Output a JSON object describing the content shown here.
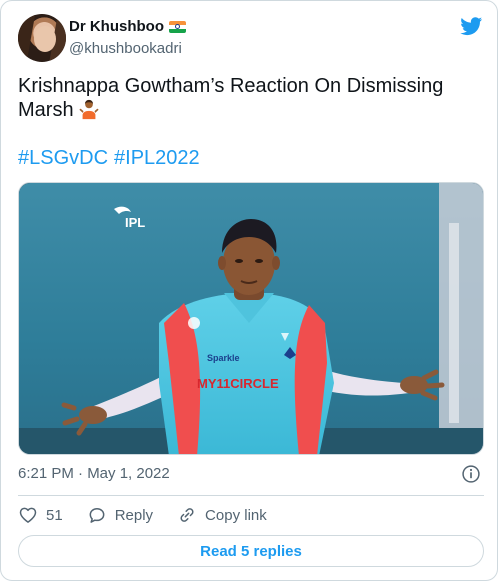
{
  "author": {
    "display_name": "Dr Khushboo",
    "handle": "@khushbookadri"
  },
  "tweet": {
    "text": "Krishnappa Gowtham’s Reaction On Dismissing Marsh",
    "hashtags": [
      "#LSGvDC",
      "#IPL2022"
    ],
    "timestamp": "6:21 PM · May 1, 2022"
  },
  "media": {
    "overlay_logo_text": "IPL",
    "jersey_sponsor_1": "Sparkle",
    "jersey_sponsor_2": "MY11CIRCLE"
  },
  "actions": {
    "like_count": "51",
    "reply_label": "Reply",
    "copy_link_label": "Copy link"
  },
  "footer": {
    "read_replies_label": "Read 5 replies"
  },
  "colors": {
    "accent": "#1d9bf0",
    "text": "#0f1419",
    "muted": "#536471",
    "border": "#cfd9de"
  },
  "icons": {
    "brand": "twitter-bird-icon",
    "info": "info-icon",
    "like": "heart-icon",
    "reply": "speech-bubble-icon",
    "copy": "link-icon"
  }
}
